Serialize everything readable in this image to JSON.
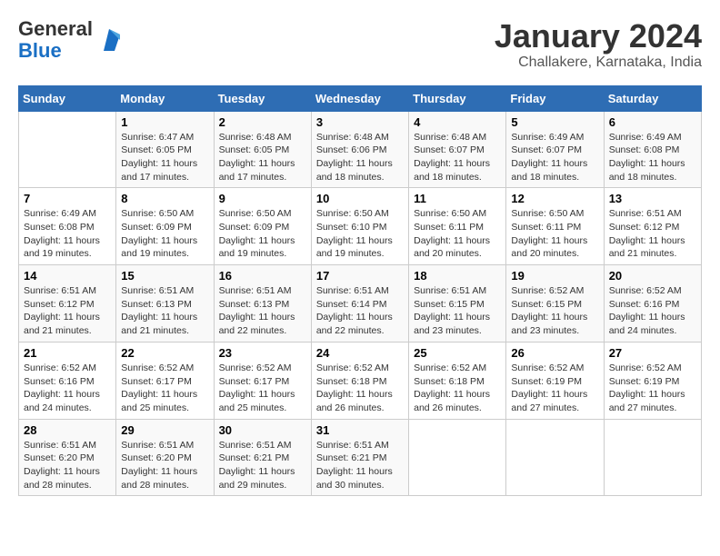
{
  "logo": {
    "text_general": "General",
    "text_blue": "Blue"
  },
  "title": "January 2024",
  "subtitle": "Challakere, Karnataka, India",
  "weekdays": [
    "Sunday",
    "Monday",
    "Tuesday",
    "Wednesday",
    "Thursday",
    "Friday",
    "Saturday"
  ],
  "weeks": [
    [
      {
        "day": "",
        "info": ""
      },
      {
        "day": "1",
        "info": "Sunrise: 6:47 AM\nSunset: 6:05 PM\nDaylight: 11 hours\nand 17 minutes."
      },
      {
        "day": "2",
        "info": "Sunrise: 6:48 AM\nSunset: 6:05 PM\nDaylight: 11 hours\nand 17 minutes."
      },
      {
        "day": "3",
        "info": "Sunrise: 6:48 AM\nSunset: 6:06 PM\nDaylight: 11 hours\nand 18 minutes."
      },
      {
        "day": "4",
        "info": "Sunrise: 6:48 AM\nSunset: 6:07 PM\nDaylight: 11 hours\nand 18 minutes."
      },
      {
        "day": "5",
        "info": "Sunrise: 6:49 AM\nSunset: 6:07 PM\nDaylight: 11 hours\nand 18 minutes."
      },
      {
        "day": "6",
        "info": "Sunrise: 6:49 AM\nSunset: 6:08 PM\nDaylight: 11 hours\nand 18 minutes."
      }
    ],
    [
      {
        "day": "7",
        "info": "Sunrise: 6:49 AM\nSunset: 6:08 PM\nDaylight: 11 hours\nand 19 minutes."
      },
      {
        "day": "8",
        "info": "Sunrise: 6:50 AM\nSunset: 6:09 PM\nDaylight: 11 hours\nand 19 minutes."
      },
      {
        "day": "9",
        "info": "Sunrise: 6:50 AM\nSunset: 6:09 PM\nDaylight: 11 hours\nand 19 minutes."
      },
      {
        "day": "10",
        "info": "Sunrise: 6:50 AM\nSunset: 6:10 PM\nDaylight: 11 hours\nand 19 minutes."
      },
      {
        "day": "11",
        "info": "Sunrise: 6:50 AM\nSunset: 6:11 PM\nDaylight: 11 hours\nand 20 minutes."
      },
      {
        "day": "12",
        "info": "Sunrise: 6:50 AM\nSunset: 6:11 PM\nDaylight: 11 hours\nand 20 minutes."
      },
      {
        "day": "13",
        "info": "Sunrise: 6:51 AM\nSunset: 6:12 PM\nDaylight: 11 hours\nand 21 minutes."
      }
    ],
    [
      {
        "day": "14",
        "info": "Sunrise: 6:51 AM\nSunset: 6:12 PM\nDaylight: 11 hours\nand 21 minutes."
      },
      {
        "day": "15",
        "info": "Sunrise: 6:51 AM\nSunset: 6:13 PM\nDaylight: 11 hours\nand 21 minutes."
      },
      {
        "day": "16",
        "info": "Sunrise: 6:51 AM\nSunset: 6:13 PM\nDaylight: 11 hours\nand 22 minutes."
      },
      {
        "day": "17",
        "info": "Sunrise: 6:51 AM\nSunset: 6:14 PM\nDaylight: 11 hours\nand 22 minutes."
      },
      {
        "day": "18",
        "info": "Sunrise: 6:51 AM\nSunset: 6:15 PM\nDaylight: 11 hours\nand 23 minutes."
      },
      {
        "day": "19",
        "info": "Sunrise: 6:52 AM\nSunset: 6:15 PM\nDaylight: 11 hours\nand 23 minutes."
      },
      {
        "day": "20",
        "info": "Sunrise: 6:52 AM\nSunset: 6:16 PM\nDaylight: 11 hours\nand 24 minutes."
      }
    ],
    [
      {
        "day": "21",
        "info": "Sunrise: 6:52 AM\nSunset: 6:16 PM\nDaylight: 11 hours\nand 24 minutes."
      },
      {
        "day": "22",
        "info": "Sunrise: 6:52 AM\nSunset: 6:17 PM\nDaylight: 11 hours\nand 25 minutes."
      },
      {
        "day": "23",
        "info": "Sunrise: 6:52 AM\nSunset: 6:17 PM\nDaylight: 11 hours\nand 25 minutes."
      },
      {
        "day": "24",
        "info": "Sunrise: 6:52 AM\nSunset: 6:18 PM\nDaylight: 11 hours\nand 26 minutes."
      },
      {
        "day": "25",
        "info": "Sunrise: 6:52 AM\nSunset: 6:18 PM\nDaylight: 11 hours\nand 26 minutes."
      },
      {
        "day": "26",
        "info": "Sunrise: 6:52 AM\nSunset: 6:19 PM\nDaylight: 11 hours\nand 27 minutes."
      },
      {
        "day": "27",
        "info": "Sunrise: 6:52 AM\nSunset: 6:19 PM\nDaylight: 11 hours\nand 27 minutes."
      }
    ],
    [
      {
        "day": "28",
        "info": "Sunrise: 6:51 AM\nSunset: 6:20 PM\nDaylight: 11 hours\nand 28 minutes."
      },
      {
        "day": "29",
        "info": "Sunrise: 6:51 AM\nSunset: 6:20 PM\nDaylight: 11 hours\nand 28 minutes."
      },
      {
        "day": "30",
        "info": "Sunrise: 6:51 AM\nSunset: 6:21 PM\nDaylight: 11 hours\nand 29 minutes."
      },
      {
        "day": "31",
        "info": "Sunrise: 6:51 AM\nSunset: 6:21 PM\nDaylight: 11 hours\nand 30 minutes."
      },
      {
        "day": "",
        "info": ""
      },
      {
        "day": "",
        "info": ""
      },
      {
        "day": "",
        "info": ""
      }
    ]
  ]
}
